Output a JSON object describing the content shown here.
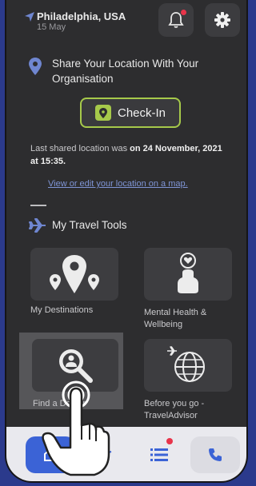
{
  "header": {
    "city": "Philadelphia, USA",
    "date": "15 May"
  },
  "share": {
    "title": "Share Your Location With Your Organisation",
    "checkin_label": "Check-In",
    "last_shared_prefix": "Last shared location was ",
    "last_shared_value": "on 24 November, 2021 at 15:35.",
    "view_link": "View or edit your location on a map."
  },
  "tools": {
    "title": "My Travel Tools",
    "items": [
      {
        "label": "My Destinations"
      },
      {
        "label": "Mental Health & Wellbeing"
      },
      {
        "label": "Find a Doctor"
      },
      {
        "label": "Before you go - TravelAdvisor"
      }
    ]
  },
  "colors": {
    "accent_green": "#a6c94a",
    "link_blue": "#7f95d6",
    "nav_active": "#3b63d6",
    "badge_red": "#e8344a"
  }
}
